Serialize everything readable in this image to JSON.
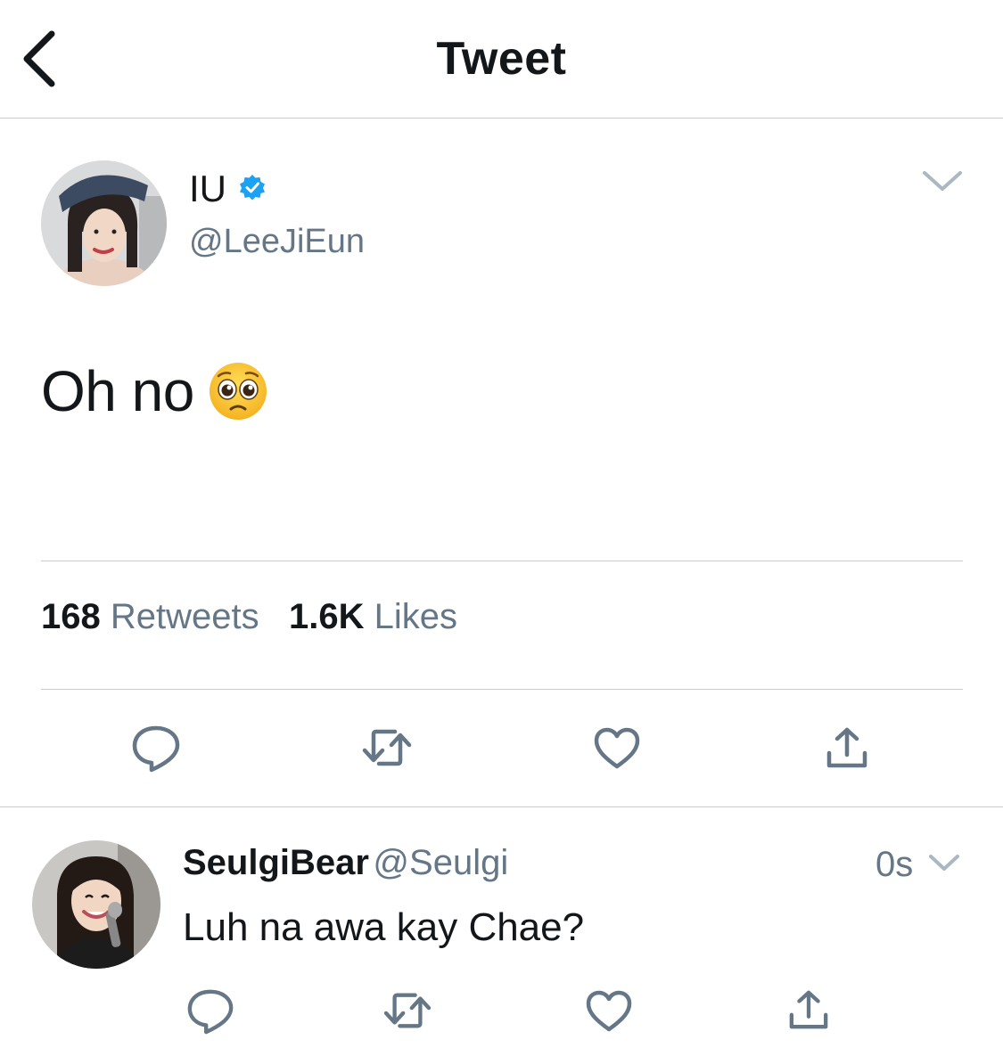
{
  "header": {
    "title": "Tweet",
    "back_icon": "chevron-left-icon"
  },
  "main_tweet": {
    "display_name": "IU",
    "handle": "@LeeJiEun",
    "verified_color": "#1da1f2",
    "text": "Oh no",
    "emoji": "pleading-face-emoji",
    "retweets_count": "168",
    "retweets_label": "Retweets",
    "likes_count": "1.6K",
    "likes_label": "Likes",
    "actions": [
      "reply-icon",
      "retweet-icon",
      "like-icon",
      "share-icon"
    ]
  },
  "reply": {
    "display_name": "SeulgiBear",
    "handle": "@Seulgi",
    "time": "0s",
    "text": "Luh na awa kay Chae?",
    "actions": [
      "reply-icon",
      "retweet-icon",
      "like-icon",
      "share-icon"
    ]
  },
  "colors": {
    "text": "#14171a",
    "secondary": "#657786",
    "divider": "#c9cdd1",
    "icon": "#657786",
    "accent": "#1da1f2"
  }
}
